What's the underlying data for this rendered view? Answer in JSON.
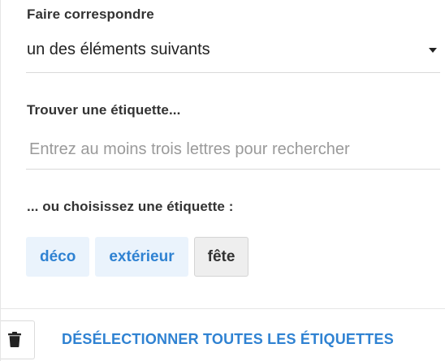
{
  "match": {
    "label": "Faire correspondre",
    "selected_value": "un des éléments suivants"
  },
  "find": {
    "label": "Trouver une étiquette...",
    "placeholder": "Entrez au moins trois lettres pour rechercher",
    "value": ""
  },
  "choose": {
    "label": "... ou choisissez une étiquette :",
    "tags": [
      {
        "label": "déco",
        "selected": false
      },
      {
        "label": "extérieur",
        "selected": false
      },
      {
        "label": "fête",
        "selected": true
      }
    ]
  },
  "footer": {
    "trash_icon": "trash-icon",
    "deselect_label": "DÉSÉLECTIONNER TOUTES LES ÉTIQUETTES"
  },
  "colors": {
    "accent": "#2f82d2",
    "tag_bg": "#eaf3fc",
    "tag_selected_bg": "#eeeeee"
  }
}
